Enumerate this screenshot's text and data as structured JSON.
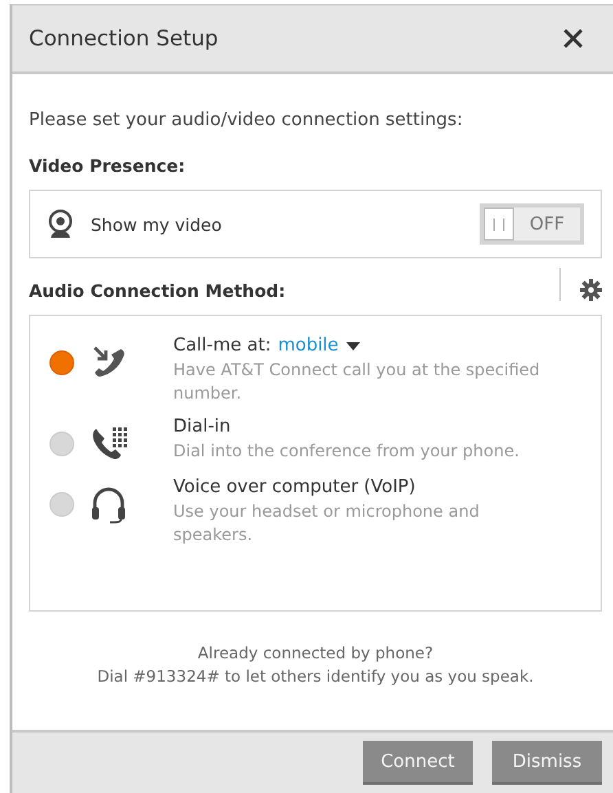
{
  "window": {
    "title": "Connection Setup"
  },
  "intro": "Please set your audio/video connection settings:",
  "video": {
    "heading": "Video Presence:",
    "label": "Show my video",
    "toggle": {
      "on": false,
      "label": "OFF"
    }
  },
  "audio": {
    "heading": "Audio Connection Method:",
    "options": [
      {
        "kind": "call-me",
        "selected": true,
        "title": "Call-me at:",
        "choice": "mobile",
        "description": "Have AT&T Connect call you at the specified number."
      },
      {
        "kind": "dial-in",
        "selected": false,
        "title": "Dial-in",
        "description": "Dial into the conference from your phone."
      },
      {
        "kind": "voip",
        "selected": false,
        "title": "Voice over computer (VoIP)",
        "description": "Use your headset or microphone and speakers."
      }
    ]
  },
  "footer_note": [
    "Already connected by phone?",
    "Dial #913324# to let others identify you as you speak."
  ],
  "buttons": [
    "Connect",
    "Dismiss"
  ]
}
